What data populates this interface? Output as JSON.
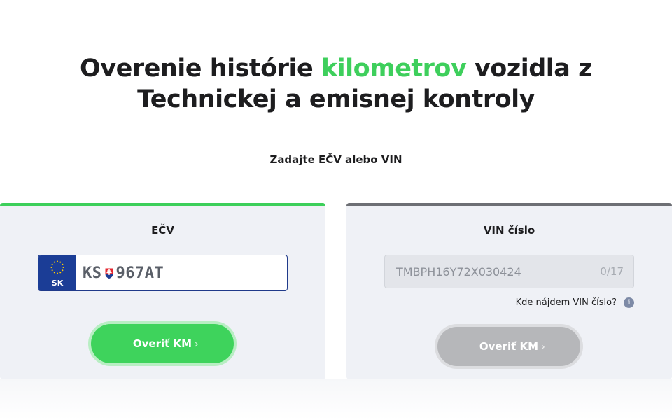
{
  "heading": {
    "part1": "Overenie histórie ",
    "accent": "kilometrov",
    "part2": " vozidla z",
    "line2": "Technickej a emisnej kontroly"
  },
  "subheading": "Zadajte EČV alebo VIN",
  "ecv_card": {
    "title": "EČV",
    "plate_country": "SK",
    "plate_prefix": "KS",
    "plate_number": "967AT",
    "button_label": "Overiť KM",
    "accent_color": "#3ccf5a"
  },
  "vin_card": {
    "title": "VIN číslo",
    "input_value": "",
    "input_placeholder": "TMBPH16Y72X030424",
    "counter": "0/17",
    "help_text": "Kde nájdem VIN číslo?",
    "button_label": "Overiť KM",
    "state": "disabled"
  },
  "icons": {
    "eu_stars": "eu-stars-icon",
    "crest": "slovak-crest-icon",
    "chevron": "chevron-right-icon",
    "info": "info-icon"
  }
}
